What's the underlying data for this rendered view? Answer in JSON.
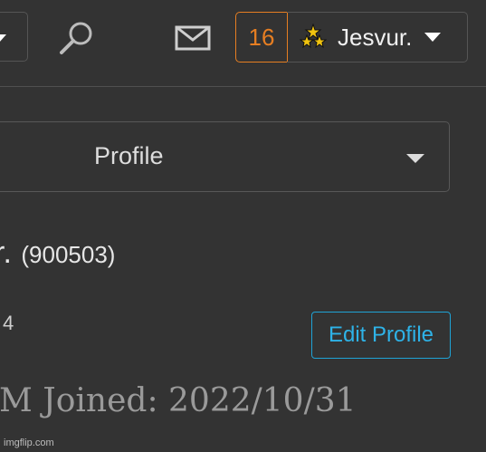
{
  "header": {
    "notifications_count": "16",
    "user_name": "Jesvur.",
    "icons": {
      "search": "search-icon",
      "mail": "mail-icon",
      "rank": "rank-stars-icon"
    }
  },
  "profile_select": {
    "selected": "Profile"
  },
  "user": {
    "name_fragment": "r.",
    "id_text": "(900503)",
    "number_fragment": "4",
    "joined_text": "M Joined: 2022/10/31"
  },
  "actions": {
    "edit_profile_label": "Edit Profile"
  },
  "watermark": "imgflip.com",
  "colors": {
    "background": "#333333",
    "notification_accent": "#e67e22",
    "edit_button_accent": "#2eb3e8"
  }
}
